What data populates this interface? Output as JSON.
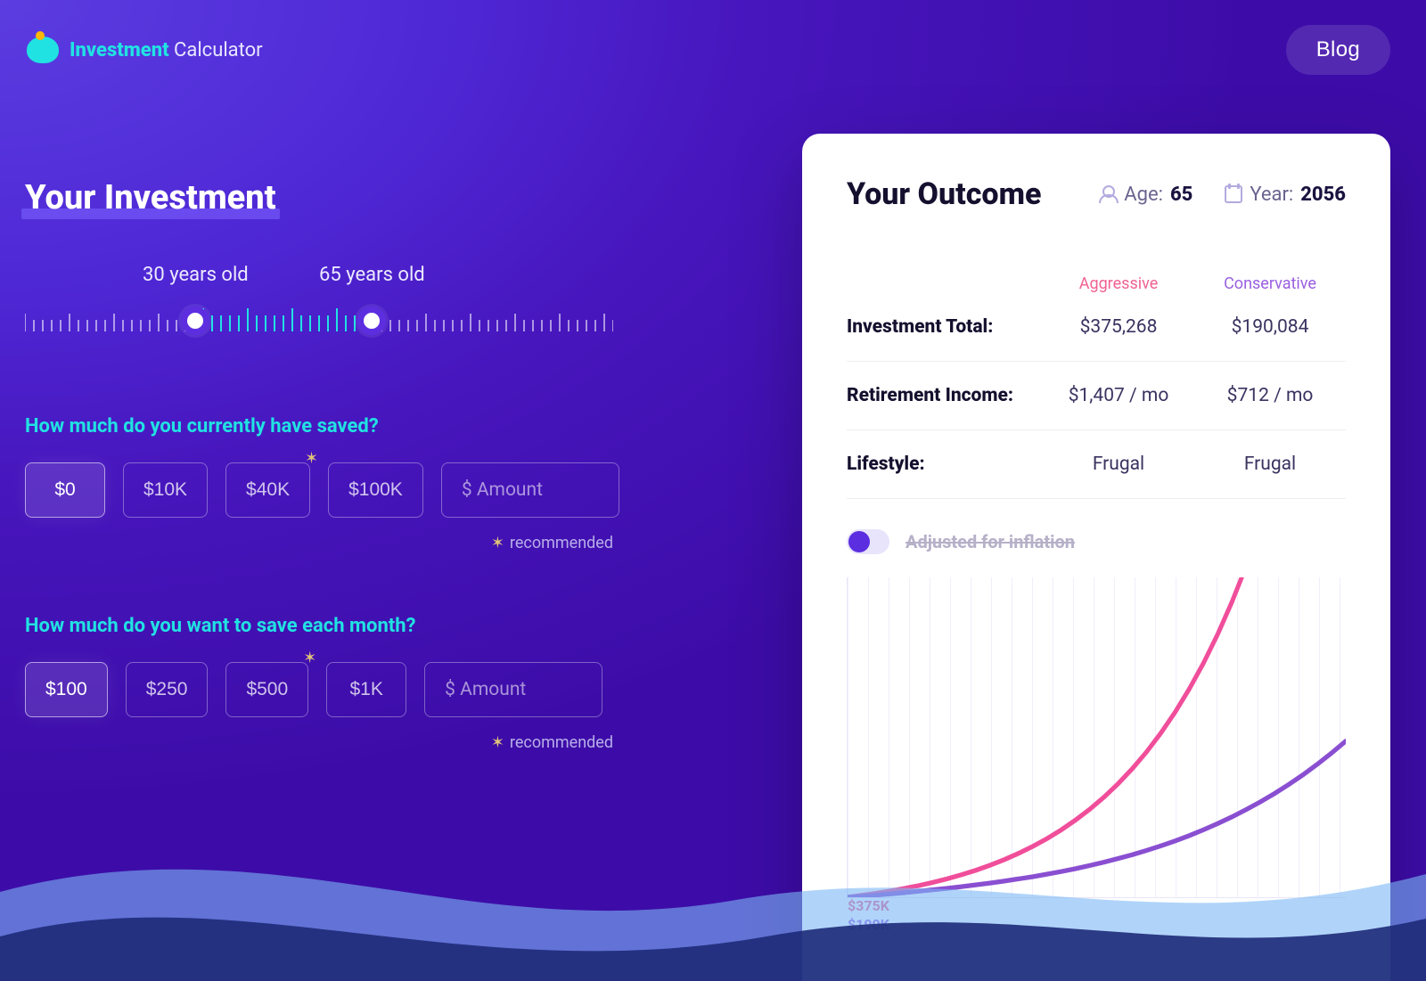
{
  "header": {
    "brand_a": "Investment",
    "brand_b": " Calculator",
    "blog": "Blog"
  },
  "left": {
    "title": "Your Investment",
    "slider": {
      "age_label": "30 years old",
      "retire_label": "65 years old",
      "age_pos_pct": 29,
      "retire_pos_pct": 59
    },
    "q_saved": "How much do you currently have saved?",
    "saved_chips": [
      "$0",
      "$10K",
      "$40K",
      "$100K"
    ],
    "saved_selected_index": 0,
    "saved_rec_index": 2,
    "q_monthly": "How much do you want to save each month?",
    "monthly_chips": [
      "$100",
      "$250",
      "$500",
      "$1K"
    ],
    "monthly_selected_index": 0,
    "monthly_rec_index": 2,
    "amount_placeholder": "$ Amount",
    "recommended_text": "recommended"
  },
  "outcome": {
    "title": "Your Outcome",
    "age_label": "Age:",
    "age_value": "65",
    "year_label": "Year:",
    "year_value": "2056",
    "head_aggressive": "Aggressive",
    "head_conservative": "Conservative",
    "rows": [
      {
        "label": "Investment Total:",
        "aggressive": "$375,268",
        "conservative": "$190,084"
      },
      {
        "label": "Retirement Income:",
        "aggressive": "$1,407 / mo",
        "conservative": "$712 / mo"
      },
      {
        "label": "Lifestyle:",
        "aggressive": "Frugal",
        "conservative": "Frugal"
      }
    ],
    "toggle_label": "Adjusted for inflation",
    "toggle_on": false,
    "chart_end_labels": {
      "aggressive": "$375K",
      "conservative": "$190K"
    }
  },
  "chart_data": {
    "type": "line",
    "xlabel": "",
    "ylabel": "",
    "x": [
      0,
      1,
      2,
      3,
      4,
      5,
      6,
      7,
      8,
      9,
      10,
      11,
      12,
      13,
      14,
      15,
      16,
      17,
      18,
      19,
      20,
      21,
      22,
      23,
      24,
      25,
      26,
      27,
      28,
      29,
      30,
      31,
      32,
      33,
      34,
      35
    ],
    "xlim": [
      0,
      35
    ],
    "ylim": [
      0,
      400000
    ],
    "series": [
      {
        "name": "Aggressive",
        "color": "#f04e9b",
        "values": [
          0,
          2300,
          4900,
          7800,
          11000,
          14600,
          18600,
          23100,
          28100,
          33700,
          40000,
          47000,
          54800,
          63500,
          73200,
          84100,
          96300,
          109900,
          125000,
          141900,
          160700,
          181700,
          205100,
          231200,
          260300,
          292700,
          328800,
          369200,
          414000,
          464000,
          519600,
          581400,
          650200,
          726600,
          811500,
          905700
        ]
      },
      {
        "name": "Conservative",
        "color": "#8a4fd1",
        "values": [
          0,
          1300,
          2700,
          4200,
          5800,
          7500,
          9300,
          11200,
          13200,
          15400,
          17700,
          20200,
          22900,
          25700,
          28800,
          32100,
          35700,
          39600,
          43800,
          48300,
          53200,
          58500,
          64200,
          70400,
          77100,
          84300,
          92100,
          100500,
          109600,
          119300,
          129800,
          141100,
          153200,
          166300,
          180300,
          195300
        ]
      }
    ]
  }
}
